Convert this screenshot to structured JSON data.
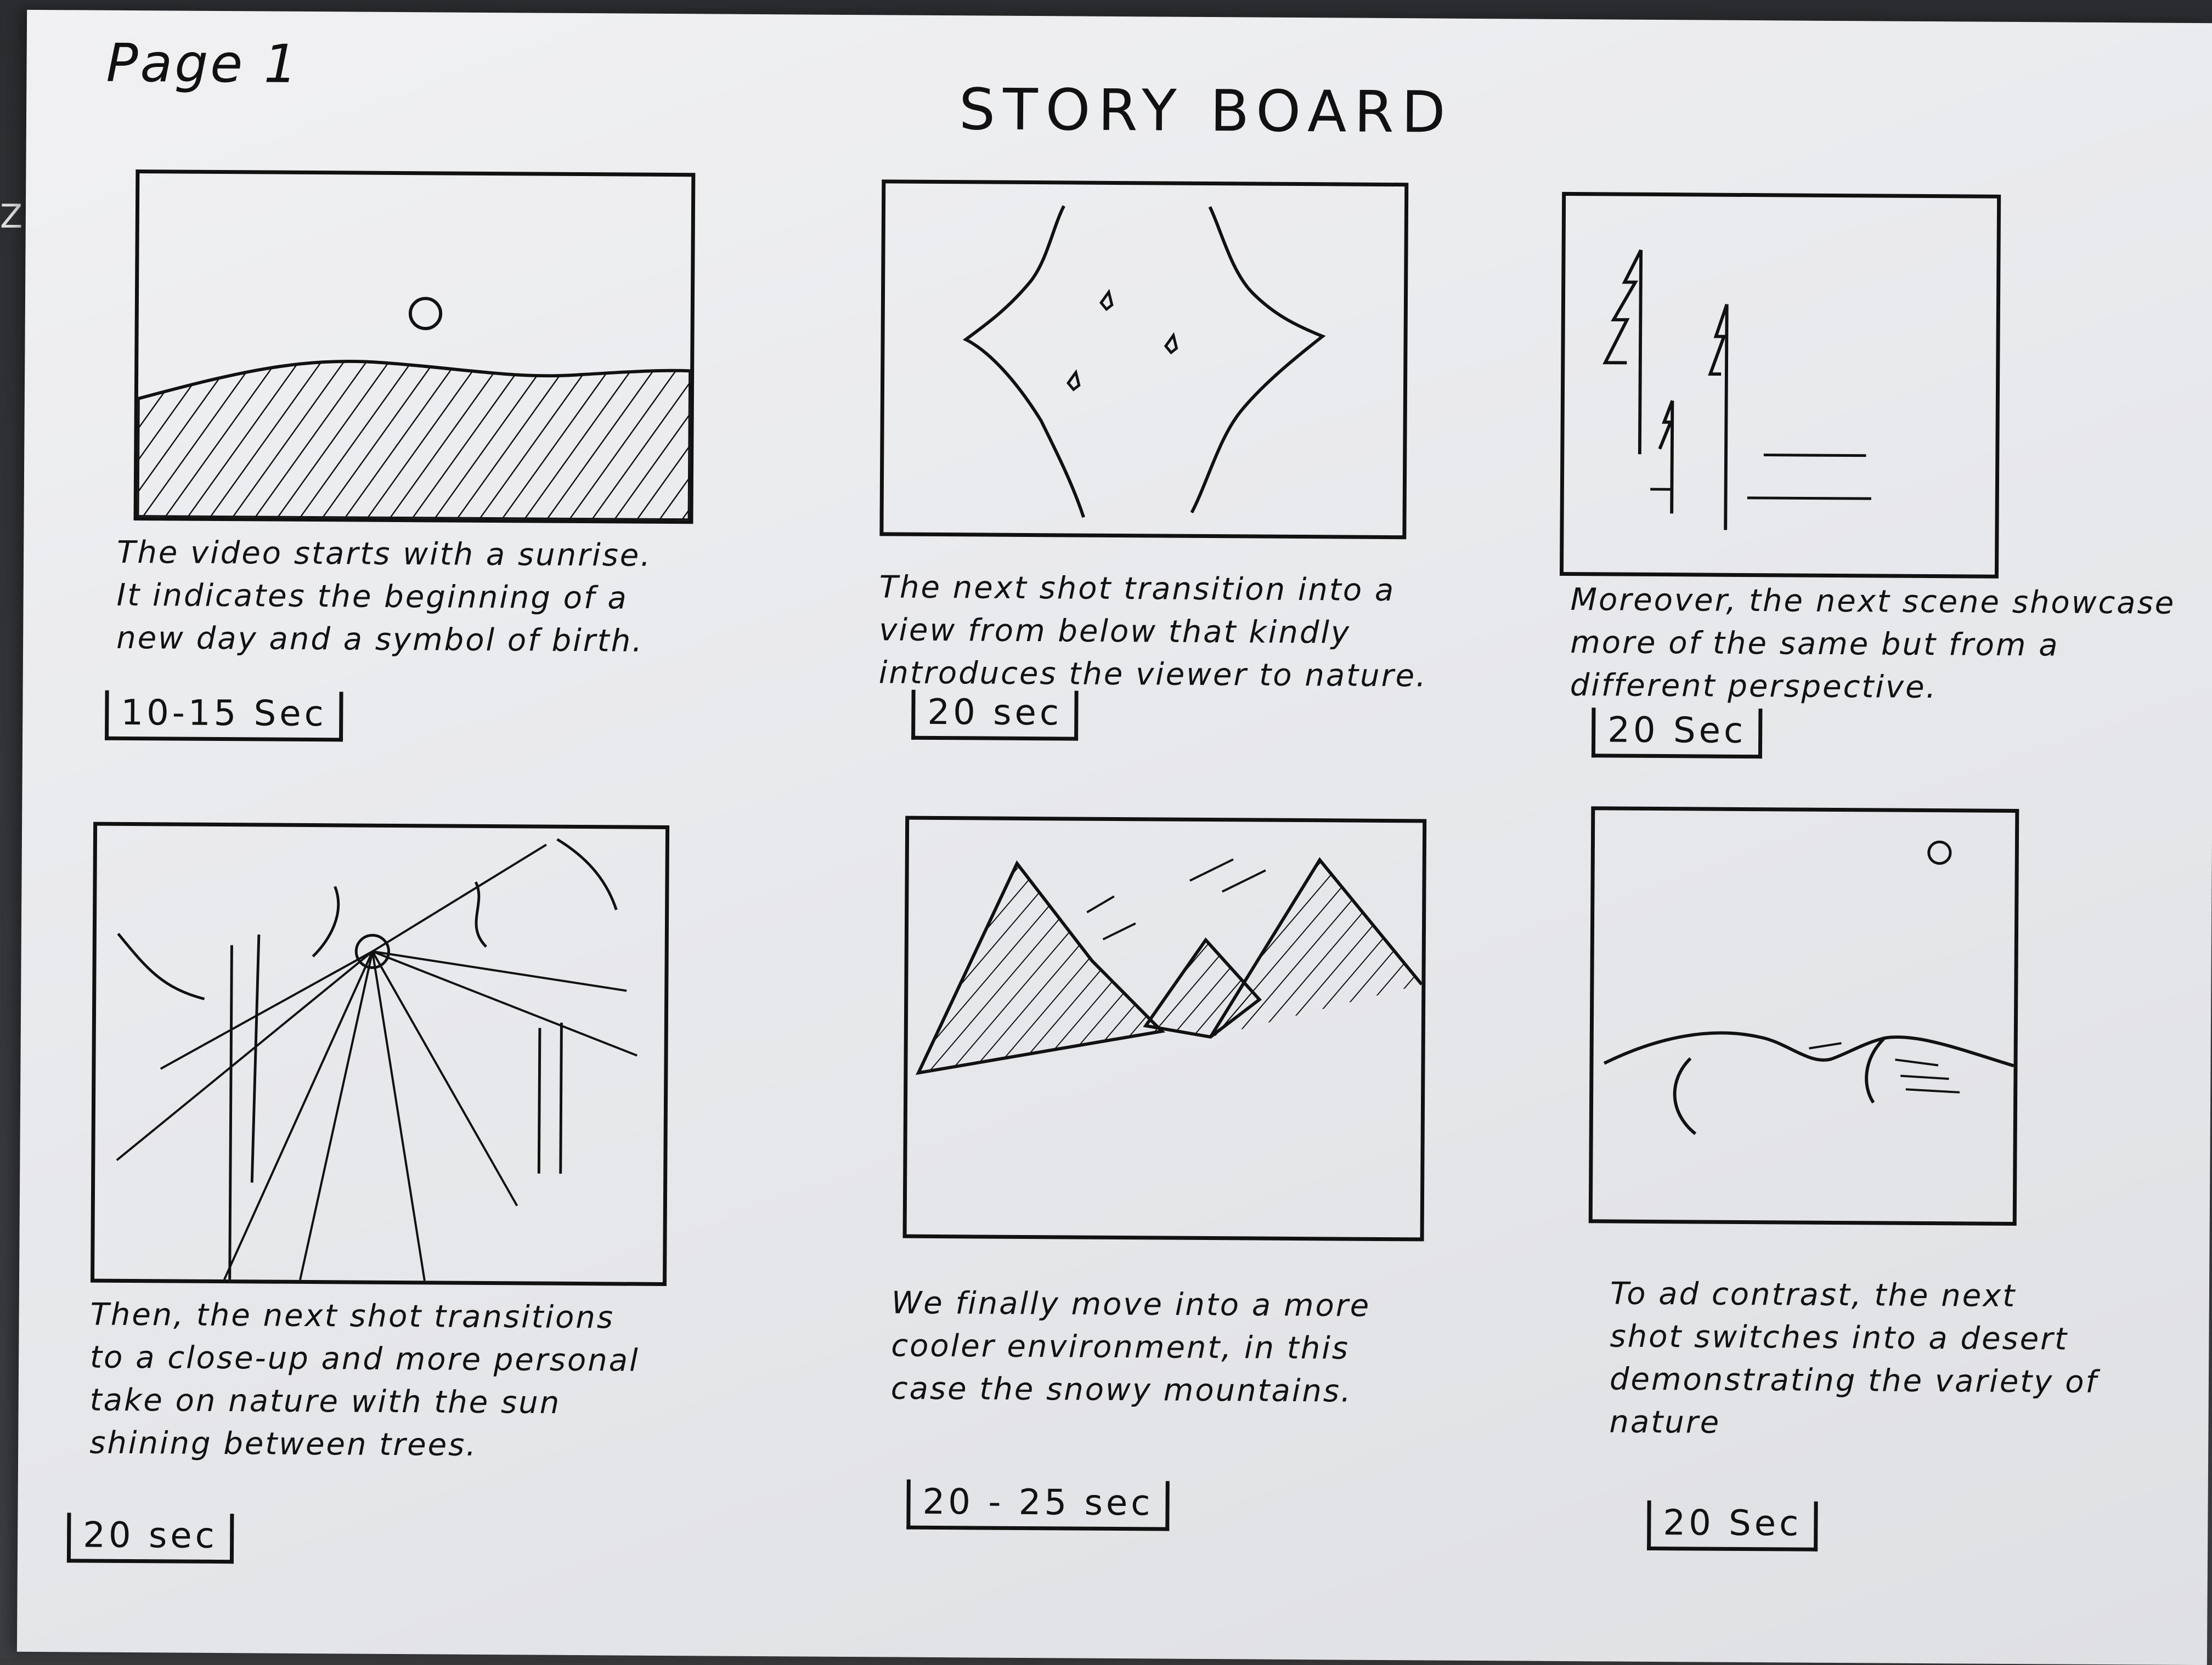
{
  "page_label": "Page 1",
  "title": "STORY BOARD",
  "panels": [
    {
      "scene": "sunrise",
      "caption_lines": [
        "The video starts with a sunrise.",
        "It indicates the beginning of a",
        "new day and a symbol of birth."
      ],
      "duration": "10-15 Sec"
    },
    {
      "scene": "view-from-below",
      "caption_lines": [
        "The next shot transition into a",
        "view from below that kindly",
        "introduces the viewer to nature."
      ],
      "duration": "20 sec"
    },
    {
      "scene": "trees-perspective",
      "caption_lines": [
        "Moreover, the next scene showcase",
        "more of the same but from a",
        "different perspective."
      ],
      "duration": "20 Sec"
    },
    {
      "scene": "sun-between-trees",
      "caption_lines": [
        "Then, the next shot transitions",
        "to a close-up and more personal",
        "take on nature with the sun",
        "shining between trees."
      ],
      "duration": "20 sec"
    },
    {
      "scene": "snowy-mountains",
      "caption_lines": [
        "We finally move into a more",
        "cooler environment, in this",
        "case the snowy mountains."
      ],
      "duration": "20 - 25 sec"
    },
    {
      "scene": "desert",
      "caption_lines": [
        "To ad contrast, the next",
        "shot switches into a desert",
        "demonstrating the variety of",
        "nature"
      ],
      "duration": "20 Sec"
    }
  ]
}
